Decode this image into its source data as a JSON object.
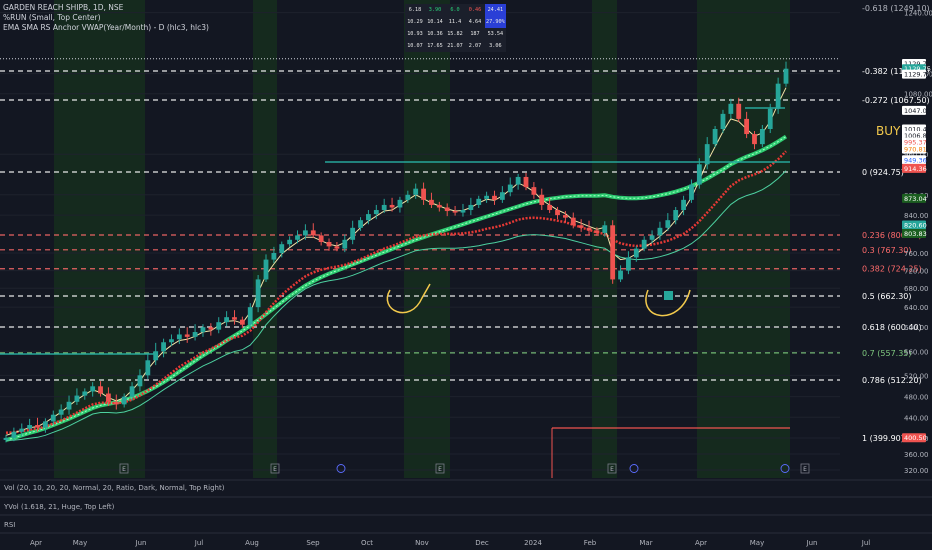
{
  "header": {
    "title": "GARDEN REACH SHIPB, 1D, NSE",
    "line2": "%RUN (Small, Top Center)",
    "line3": "EMA SMA RS Anchor VWAP(Year/Month) - D (hlc3, hlc3)"
  },
  "table": {
    "rows": [
      [
        "6.18",
        "3.90",
        "6.0",
        "0.46",
        "24.41"
      ],
      [
        "10.29",
        "10.14",
        "11.4",
        "4.64",
        "27.90%"
      ],
      [
        "10.93",
        "10.36",
        "15.82",
        "187",
        "53.54"
      ],
      [
        "10.07",
        "17.65",
        "21.07",
        "2.07",
        "3.06"
      ]
    ]
  },
  "panes": {
    "vol": "Vol (20, 10, 20, 20, Normal, 20, Ratio, Dark, Normal, Top Right)",
    "yvol": "YVol (1.618, 21, Huge, Top Left)",
    "rsi": "RSI"
  },
  "annotation": {
    "buy": "BUY"
  },
  "chart_data": {
    "type": "line",
    "title": "GARDEN REACH SHIPB, 1D, NSE",
    "ylim": [
      300,
      1260
    ],
    "y_ticks": [
      "1240.00",
      "1120.00",
      "1080.00",
      "960.00",
      "880.00",
      "840.00",
      "760.00",
      "720.00",
      "680.00",
      "640.00",
      "600.00",
      "560.00",
      "520.00",
      "480.00",
      "440.00",
      "400.00",
      "360.00",
      "320.00"
    ],
    "x_ticks": [
      "Apr",
      "May",
      "Jun",
      "Jul",
      "Aug",
      "Sep",
      "Oct",
      "Nov",
      "Dec",
      "2024",
      "Feb",
      "Mar",
      "Apr",
      "May",
      "Jun",
      "Jul"
    ],
    "fib_levels": [
      {
        "label": "-0.618 (1249.10)",
        "value": 1249.1,
        "color": "#b2b5be",
        "style": "none"
      },
      {
        "label": "-0.382 (1125.25)",
        "value": 1125.25,
        "color": "#ffffff",
        "style": "dash"
      },
      {
        "label": "-0.272 (1067.50)",
        "value": 1067.5,
        "color": "#ffffff",
        "style": "dash"
      },
      {
        "label": "0 (924.75)",
        "value": 924.75,
        "color": "#ffffff",
        "style": "dash"
      },
      {
        "label": "0.236 (800.90)",
        "value": 800.9,
        "color": "#ff6b6b",
        "style": "dash"
      },
      {
        "label": "0.3 (767.30)",
        "value": 767.3,
        "color": "#ff6b6b",
        "style": "dash"
      },
      {
        "label": "0.382 (724.25)",
        "value": 724.25,
        "color": "#ff6b6b",
        "style": "dash"
      },
      {
        "label": "0.5 (662.30)",
        "value": 662.3,
        "color": "#ffffff",
        "style": "dash"
      },
      {
        "label": "0.618 (600.40)",
        "value": 600.4,
        "color": "#ffffff",
        "style": "dash"
      },
      {
        "label": "0.7 (557.35)",
        "value": 557.35,
        "color": "#7fc97f",
        "style": "dash"
      },
      {
        "label": "0.786 (512.20)",
        "value": 512.2,
        "color": "#ffffff",
        "style": "dash"
      },
      {
        "label": "1 (399.90)",
        "value": 399.9,
        "color": "#ffffff",
        "style": "none"
      }
    ],
    "price_tags": [
      {
        "text": "1129.75",
        "value": 1140,
        "bg": "#ffffff",
        "fg": "#131722"
      },
      {
        "text": "1129.75",
        "value": 1129.75,
        "bg": "#26a69a",
        "fg": "#ffffff"
      },
      {
        "text": "1129.75",
        "value": 1119,
        "bg": "#ffffff",
        "fg": "#131722"
      },
      {
        "text": "1047.05",
        "value": 1047,
        "bg": "#ffffff",
        "fg": "#131722"
      },
      {
        "text": "1010.40",
        "value": 1010,
        "bg": "#ffffff",
        "fg": "#131722"
      },
      {
        "text": "1006.83",
        "value": 997,
        "bg": "#ffffff",
        "fg": "#131722"
      },
      {
        "text": "995.37",
        "value": 984,
        "bg": "#ffffff",
        "fg": "#ef5350"
      },
      {
        "text": "970.81",
        "value": 970,
        "bg": "#ffffff",
        "fg": "#f57c00"
      },
      {
        "text": "949.36",
        "value": 949,
        "bg": "#ffffff",
        "fg": "#2962ff"
      },
      {
        "text": "914.36",
        "value": 932,
        "bg": "#ef5350",
        "fg": "#ffffff"
      },
      {
        "text": "873.04",
        "value": 873,
        "bg": "#1b5e20",
        "fg": "#ffffff"
      },
      {
        "text": "820.60",
        "value": 820.6,
        "bg": "#26a69a",
        "fg": "#ffffff"
      },
      {
        "text": "803.83",
        "value": 803.8,
        "bg": "#1b5e20",
        "fg": "#ffffff"
      },
      {
        "text": "400.50",
        "value": 400.5,
        "bg": "#ef5350",
        "fg": "#ffffff"
      }
    ],
    "close": [
      400,
      412,
      418,
      425,
      420,
      432,
      445,
      455,
      470,
      482,
      490,
      500,
      486,
      470,
      465,
      480,
      500,
      520,
      545,
      560,
      575,
      580,
      588,
      584,
      592,
      600,
      596,
      610,
      620,
      615,
      605,
      640,
      700,
      745,
      760,
      780,
      790,
      800,
      810,
      800,
      785,
      775,
      770,
      790,
      815,
      830,
      842,
      850,
      860,
      855,
      870,
      880,
      892,
      870,
      860,
      855,
      848,
      845,
      850,
      860,
      872,
      878,
      870,
      885,
      900,
      915,
      895,
      880,
      860,
      850,
      840,
      835,
      820,
      815,
      810,
      805,
      820,
      700,
      720,
      750,
      770,
      790,
      800,
      815,
      830,
      850,
      870,
      900,
      940,
      980,
      1010,
      1040,
      1060,
      1030,
      1000,
      980,
      1010,
      1050,
      1100,
      1129.75
    ],
    "ema_fast": [
      405,
      410,
      415,
      420,
      422,
      430,
      440,
      450,
      462,
      474,
      484,
      493,
      488,
      478,
      472,
      478,
      492,
      510,
      530,
      546,
      560,
      570,
      578,
      580,
      585,
      592,
      594,
      603,
      612,
      613,
      608,
      630,
      670,
      710,
      735,
      758,
      772,
      785,
      796,
      796,
      788,
      780,
      776,
      784,
      800,
      815,
      828,
      838,
      848,
      850,
      860,
      870,
      880,
      872,
      864,
      858,
      852,
      848,
      849,
      855,
      864,
      871,
      869,
      878,
      890,
      903,
      896,
      886,
      870,
      860,
      850,
      843,
      830,
      824,
      818,
      812,
      816,
      760,
      745,
      748,
      758,
      772,
      784,
      798,
      812,
      830,
      850,
      875,
      908,
      945,
      975,
      1005,
      1030,
      1025,
      1010,
      996,
      1002,
      1025,
      1060,
      1092
    ],
    "sma_mid": [
      410,
      411,
      413,
      416,
      418,
      422,
      428,
      434,
      441,
      449,
      457,
      465,
      468,
      468,
      467,
      469,
      474,
      482,
      492,
      503,
      514,
      524,
      534,
      542,
      550,
      558,
      564,
      571,
      578,
      583,
      586,
      594,
      610,
      630,
      648,
      665,
      680,
      694,
      707,
      716,
      722,
      726,
      729,
      733,
      739,
      746,
      754,
      762,
      770,
      776,
      783,
      790,
      797,
      800,
      802,
      803,
      803,
      803,
      804,
      806,
      809,
      813,
      816,
      820,
      825,
      831,
      834,
      835,
      834,
      832,
      829,
      826,
      821,
      816,
      811,
      806,
      803,
      790,
      782,
      778,
      776,
      777,
      779,
      783,
      788,
      795,
      803,
      814,
      828,
      845,
      862,
      880,
      897,
      908,
      915,
      920,
      927,
      937,
      950,
      966
    ],
    "vwap": [
      395,
      400,
      405,
      410,
      414,
      419,
      425,
      431,
      437,
      444,
      451,
      458,
      463,
      466,
      469,
      473,
      478,
      484,
      491,
      499,
      508,
      517,
      526,
      535,
      544,
      553,
      561,
      569,
      578,
      586,
      594,
      603,
      614,
      626,
      638,
      650,
      662,
      674,
      686,
      696,
      705,
      713,
      720,
      727,
      734,
      741,
      748,
      755,
      762,
      769,
      776,
      783,
      790,
      796,
      802,
      807,
      812,
      817,
      822,
      827,
      832,
      837,
      842,
      847,
      852,
      857,
      862,
      866,
      869,
      872,
      874,
      876,
      877,
      878,
      878,
      878,
      879,
      876,
      874,
      873,
      873,
      874,
      876,
      879,
      882,
      886,
      891,
      897,
      904,
      912,
      921,
      930,
      940,
      948,
      955,
      961,
      968,
      976,
      985,
      995
    ]
  }
}
